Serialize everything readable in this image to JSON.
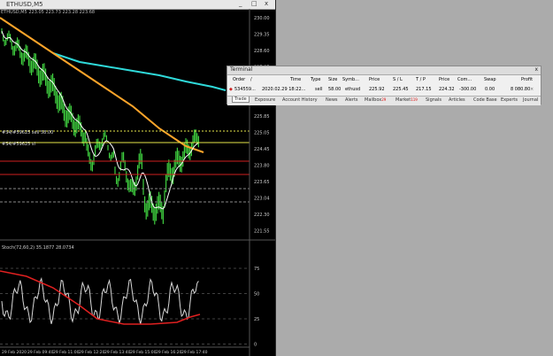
{
  "chart_window": {
    "title": "ETHUSD,M5",
    "ctl_min": "_",
    "ctl_max": "□",
    "ctl_close": "x",
    "info_text": "ETHUSD,M5  223.05 223.73 223.28 223.68"
  },
  "price_chart": {
    "price_labels": [
      "230.00",
      "229.35",
      "228.60",
      "227.85",
      "227.05",
      "226.30",
      "225.85",
      "225.05",
      "224.45",
      "223.80",
      "223.65",
      "223.04",
      "222.30",
      "221.55"
    ],
    "order_label_1": "#S4/#59625 sell 58.00",
    "order_label_2": "#S4/#59625 sl"
  },
  "stoch": {
    "label": "Stoch(72,60,2) 35.1877 28.0734",
    "levels": [
      "75",
      "50",
      "25",
      "0"
    ]
  },
  "time_axis": [
    "29 Feb 2020",
    "29 Feb 09:40",
    "29 Feb 11:00",
    "29 Feb 12:20",
    "29 Feb 13:40",
    "29 Feb 15:00",
    "29 Feb 16:20",
    "29 Feb 17:40"
  ],
  "colors": {
    "candles": "#3fcf3f",
    "ma_fast": "#ffffff",
    "ma_mid": "#ffa52a",
    "ma_slow": "#2fd9d9",
    "entry_line": "#e6e64a",
    "sl_line": "#d02020",
    "stoch_main": "#e02020",
    "stoch_signal": "#d8d8d8"
  },
  "terminal": {
    "title": "Terminal",
    "close": "x",
    "headers": [
      "Order",
      "/",
      "Time",
      "Type",
      "Size",
      "Symb...",
      "Price",
      "S / L",
      "T / P",
      "Price",
      "Com...",
      "Swap",
      "Profit"
    ],
    "row": [
      "534559...",
      "2020.02.29 18:22...",
      "sell",
      "58.00",
      "ethusd",
      "225.92",
      "225.45",
      "217.15",
      "224.32",
      "-300.00",
      "0.00",
      "8 080.80"
    ],
    "tabs": [
      "Trade",
      "Exposure",
      "Account History",
      "News",
      "Alerts",
      "Mailbox",
      "Market",
      "Signals",
      "Articles",
      "Code Base",
      "Experts",
      "Journal"
    ],
    "mailbox_badge": "29",
    "market_badge": "119"
  }
}
